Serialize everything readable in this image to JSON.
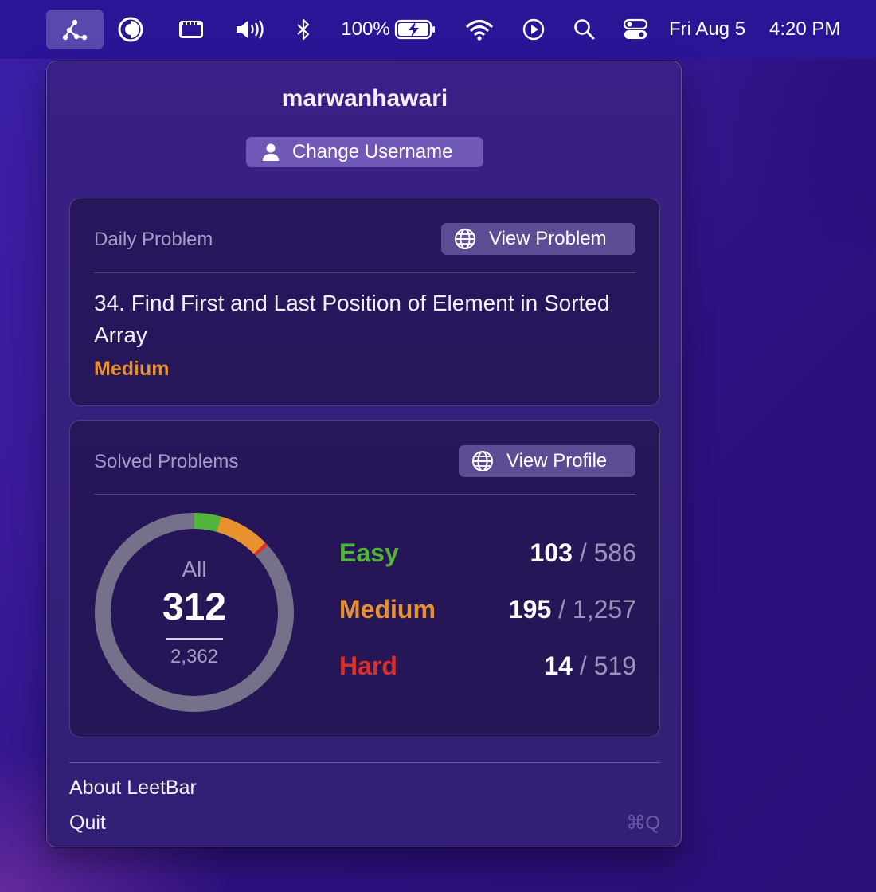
{
  "menubar": {
    "icons": [
      "leetbar-graph-icon",
      "contrast-icon",
      "video-window-icon",
      "speaker-volume-icon",
      "bluetooth-icon",
      "battery-charging-icon",
      "wifi-icon",
      "play-circle-icon",
      "search-icon",
      "control-center-icon"
    ],
    "battery_percent": "100%",
    "date": "Fri Aug 5",
    "time": "4:20 PM"
  },
  "popover": {
    "username": "marwanhawari",
    "change_username_label": "Change Username",
    "daily": {
      "label": "Daily Problem",
      "button_label": "View Problem",
      "problem_title": "34. Find First and Last Position of Element in Sorted Array",
      "difficulty": "Medium"
    },
    "solved": {
      "label": "Solved Problems",
      "button_label": "View Profile",
      "all_label": "All",
      "solved_count": "312",
      "total_count": "2,362",
      "rows": [
        {
          "name": "Easy",
          "solved": "103",
          "sep": "/",
          "total": "586",
          "solved_value": 103,
          "total_value": 586,
          "color": "#52b43a"
        },
        {
          "name": "Medium",
          "solved": "195",
          "sep": "/",
          "total": "1,257",
          "solved_value": 195,
          "total_value": 1257,
          "color": "#e8922f"
        },
        {
          "name": "Hard",
          "solved": "14",
          "sep": "/",
          "total": "519",
          "solved_value": 14,
          "total_value": 519,
          "color": "#d9302b"
        }
      ]
    },
    "menu": {
      "about_label": "About LeetBar",
      "quit_label": "Quit",
      "quit_shortcut": "⌘Q"
    }
  },
  "colors": {
    "easy": "#52b43a",
    "medium": "#e8922f",
    "hard": "#d9302b",
    "ring_track": "#75718a",
    "button": "#6f58b6"
  }
}
